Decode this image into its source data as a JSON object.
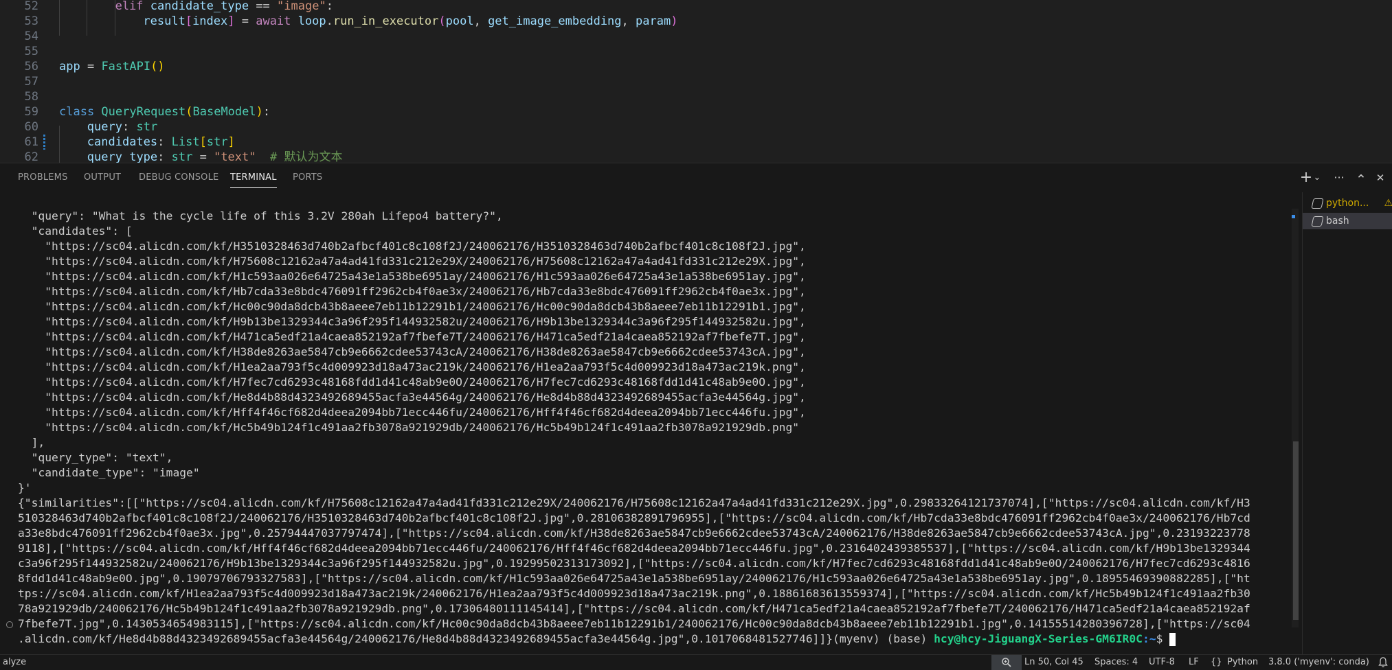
{
  "editor": {
    "lines": [
      {
        "num": "52",
        "html": [
          [
            "kw",
            "elif "
          ],
          [
            "var",
            "candidate_type"
          ],
          [
            "",
            " == "
          ],
          [
            "str",
            "\"image\""
          ],
          [
            "",
            ":"
          ]
        ],
        "indent": 8
      },
      {
        "num": "53",
        "html": [
          [
            "var",
            "result"
          ],
          [
            "br2",
            "["
          ],
          [
            "var",
            "index"
          ],
          [
            "br2",
            "]"
          ],
          [
            "",
            " = "
          ],
          [
            "kw",
            "await "
          ],
          [
            "var",
            "loop"
          ],
          [
            "",
            "."
          ],
          [
            "fn",
            "run_in_executor"
          ],
          [
            "br2",
            "("
          ],
          [
            "var",
            "pool"
          ],
          [
            "",
            ", "
          ],
          [
            "var",
            "get_image_embedding"
          ],
          [
            "",
            ", "
          ],
          [
            "var",
            "param"
          ],
          [
            "br2",
            ")"
          ]
        ],
        "indent": 12
      },
      {
        "num": "54",
        "html": [],
        "indent": 0
      },
      {
        "num": "55",
        "html": [],
        "indent": 0
      },
      {
        "num": "56",
        "html": [
          [
            "var",
            "app"
          ],
          [
            "",
            " = "
          ],
          [
            "cls",
            "FastAPI"
          ],
          [
            "br",
            "()"
          ]
        ],
        "indent": 0
      },
      {
        "num": "57",
        "html": [],
        "indent": 0
      },
      {
        "num": "58",
        "html": [],
        "indent": 0
      },
      {
        "num": "59",
        "html": [
          [
            "kw2",
            "class "
          ],
          [
            "cls",
            "QueryRequest"
          ],
          [
            "br",
            "("
          ],
          [
            "cls",
            "BaseModel"
          ],
          [
            "br",
            ")"
          ],
          [
            "",
            ":"
          ]
        ],
        "indent": 0
      },
      {
        "num": "60",
        "html": [
          [
            "var",
            "query"
          ],
          [
            "",
            ": "
          ],
          [
            "cls",
            "str"
          ]
        ],
        "indent": 4
      },
      {
        "num": "61",
        "html": [
          [
            "var",
            "candidates"
          ],
          [
            "",
            ": "
          ],
          [
            "cls",
            "List"
          ],
          [
            "br",
            "["
          ],
          [
            "cls",
            "str"
          ],
          [
            "br",
            "]"
          ]
        ],
        "indent": 4
      },
      {
        "num": "62",
        "html": [
          [
            "var",
            "query_type"
          ],
          [
            "",
            ": "
          ],
          [
            "cls",
            "str"
          ],
          [
            "",
            " = "
          ],
          [
            "str",
            "\"text\""
          ],
          [
            "",
            "  "
          ],
          [
            "",
            "# 默认为文本"
          ]
        ],
        "indent": 4
      }
    ]
  },
  "panel": {
    "tabs": [
      {
        "label": "PROBLEMS",
        "active": false
      },
      {
        "label": "OUTPUT",
        "active": false
      },
      {
        "label": "DEBUG CONSOLE",
        "active": false
      },
      {
        "label": "TERMINAL",
        "active": true
      },
      {
        "label": "PORTS",
        "active": false
      }
    ],
    "actions": {
      "new_terminal": "+",
      "dropdown": "⌄",
      "more": "···",
      "maximize": "⌃",
      "close": "✕"
    },
    "terminal_list": [
      {
        "label": "python...",
        "warning": "⚠",
        "selected": false
      },
      {
        "label": "bash",
        "warning": "",
        "selected": true
      }
    ]
  },
  "terminal": {
    "lines": [
      "  \"query\": \"What is the cycle life of this 3.2V 280ah Lifepo4 battery?\",",
      "  \"candidates\": [",
      "    \"https://sc04.alicdn.com/kf/H3510328463d740b2afbcf401c8c108f2J/240062176/H3510328463d740b2afbcf401c8c108f2J.jpg\",",
      "    \"https://sc04.alicdn.com/kf/H75608c12162a47a4ad41fd331c212e29X/240062176/H75608c12162a47a4ad41fd331c212e29X.jpg\",",
      "    \"https://sc04.alicdn.com/kf/H1c593aa026e64725a43e1a538be6951ay/240062176/H1c593aa026e64725a43e1a538be6951ay.jpg\",",
      "    \"https://sc04.alicdn.com/kf/Hb7cda33e8bdc476091ff2962cb4f0ae3x/240062176/Hb7cda33e8bdc476091ff2962cb4f0ae3x.jpg\",",
      "    \"https://sc04.alicdn.com/kf/Hc00c90da8dcb43b8aeee7eb11b12291b1/240062176/Hc00c90da8dcb43b8aeee7eb11b12291b1.jpg\",",
      "    \"https://sc04.alicdn.com/kf/H9b13be1329344c3a96f295f144932582u/240062176/H9b13be1329344c3a96f295f144932582u.jpg\",",
      "    \"https://sc04.alicdn.com/kf/H471ca5edf21a4caea852192af7fbefe7T/240062176/H471ca5edf21a4caea852192af7fbefe7T.jpg\",",
      "    \"https://sc04.alicdn.com/kf/H38de8263ae5847cb9e6662cdee53743cA/240062176/H38de8263ae5847cb9e6662cdee53743cA.jpg\",",
      "    \"https://sc04.alicdn.com/kf/H1ea2aa793f5c4d009923d18a473ac219k/240062176/H1ea2aa793f5c4d009923d18a473ac219k.png\",",
      "    \"https://sc04.alicdn.com/kf/H7fec7cd6293c48168fdd1d41c48ab9e0O/240062176/H7fec7cd6293c48168fdd1d41c48ab9e0O.jpg\",",
      "    \"https://sc04.alicdn.com/kf/He8d4b88d4323492689455acfa3e44564g/240062176/He8d4b88d4323492689455acfa3e44564g.jpg\",",
      "    \"https://sc04.alicdn.com/kf/Hff4f46cf682d4deea2094bb71ecc446fu/240062176/Hff4f46cf682d4deea2094bb71ecc446fu.jpg\",",
      "    \"https://sc04.alicdn.com/kf/Hc5b49b124f1c491aa2fb3078a921929db/240062176/Hc5b49b124f1c491aa2fb3078a921929db.png\"",
      "  ],",
      "  \"query_type\": \"text\",",
      "  \"candidate_type\": \"image\"",
      "}'",
      "{\"similarities\":[[\"https://sc04.alicdn.com/kf/H75608c12162a47a4ad41fd331c212e29X/240062176/H75608c12162a47a4ad41fd331c212e29X.jpg\",0.29833264121737074],[\"https://sc04.alicdn.com/kf/H3",
      "510328463d740b2afbcf401c8c108f2J/240062176/H3510328463d740b2afbcf401c8c108f2J.jpg\",0.28106382891796955],[\"https://sc04.alicdn.com/kf/Hb7cda33e8bdc476091ff2962cb4f0ae3x/240062176/Hb7cd",
      "a33e8bdc476091ff2962cb4f0ae3x.jpg\",0.25794447037797474],[\"https://sc04.alicdn.com/kf/H38de8263ae5847cb9e6662cdee53743cA/240062176/H38de8263ae5847cb9e6662cdee53743cA.jpg\",0.23193223778",
      "9118],[\"https://sc04.alicdn.com/kf/Hff4f46cf682d4deea2094bb71ecc446fu/240062176/Hff4f46cf682d4deea2094bb71ecc446fu.jpg\",0.2316402439385537],[\"https://sc04.alicdn.com/kf/H9b13be1329344",
      "c3a96f295f144932582u/240062176/H9b13be1329344c3a96f295f144932582u.jpg\",0.19299502313173092],[\"https://sc04.alicdn.com/kf/H7fec7cd6293c48168fdd1d41c48ab9e0O/240062176/H7fec7cd6293c4816",
      "8fdd1d41c48ab9e0O.jpg\",0.19079706793327583],[\"https://sc04.alicdn.com/kf/H1c593aa026e64725a43e1a538be6951ay/240062176/H1c593aa026e64725a43e1a538be6951ay.jpg\",0.18955469390882285],[\"ht",
      "tps://sc04.alicdn.com/kf/H1ea2aa793f5c4d009923d18a473ac219k/240062176/H1ea2aa793f5c4d009923d18a473ac219k.png\",0.18861683613559374],[\"https://sc04.alicdn.com/kf/Hc5b49b124f1c491aa2fb30",
      "78a921929db/240062176/Hc5b49b124f1c491aa2fb3078a921929db.png\",0.17306480111145414],[\"https://sc04.alicdn.com/kf/H471ca5edf21a4caea852192af7fbefe7T/240062176/H471ca5edf21a4caea852192af",
      "7fbefe7T.jpg\",0.1430534654983115],[\"https://sc04.alicdn.com/kf/Hc00c90da8dcb43b8aeee7eb11b12291b1/240062176/Hc00c90da8dcb43b8aeee7eb11b12291b1.jpg\",0.14155514280396728],[\"https://sc04"
    ],
    "last_line": ".alicdn.com/kf/He8d4b88d4323492689455acfa3e44564g/240062176/He8d4b88d4323492689455acfa3e44564g.jpg\",0.1017068481527746]]}(myenv) (base) ",
    "prompt_user": "hcy@hcy-JiguangX-Series-GM6IR0C",
    "prompt_path": ":~",
    "prompt_symbol": "$ "
  },
  "statusbar": {
    "left_text": "alyze",
    "zoom_icon": "zoom-icon",
    "position": "Ln 50, Col 45",
    "spaces": "Spaces: 4",
    "encoding": "UTF-8",
    "eol": "LF",
    "language_icon": "{}",
    "language": "Python",
    "interpreter": "3.8.0 ('myenv': conda)",
    "bell": "bell-icon"
  }
}
